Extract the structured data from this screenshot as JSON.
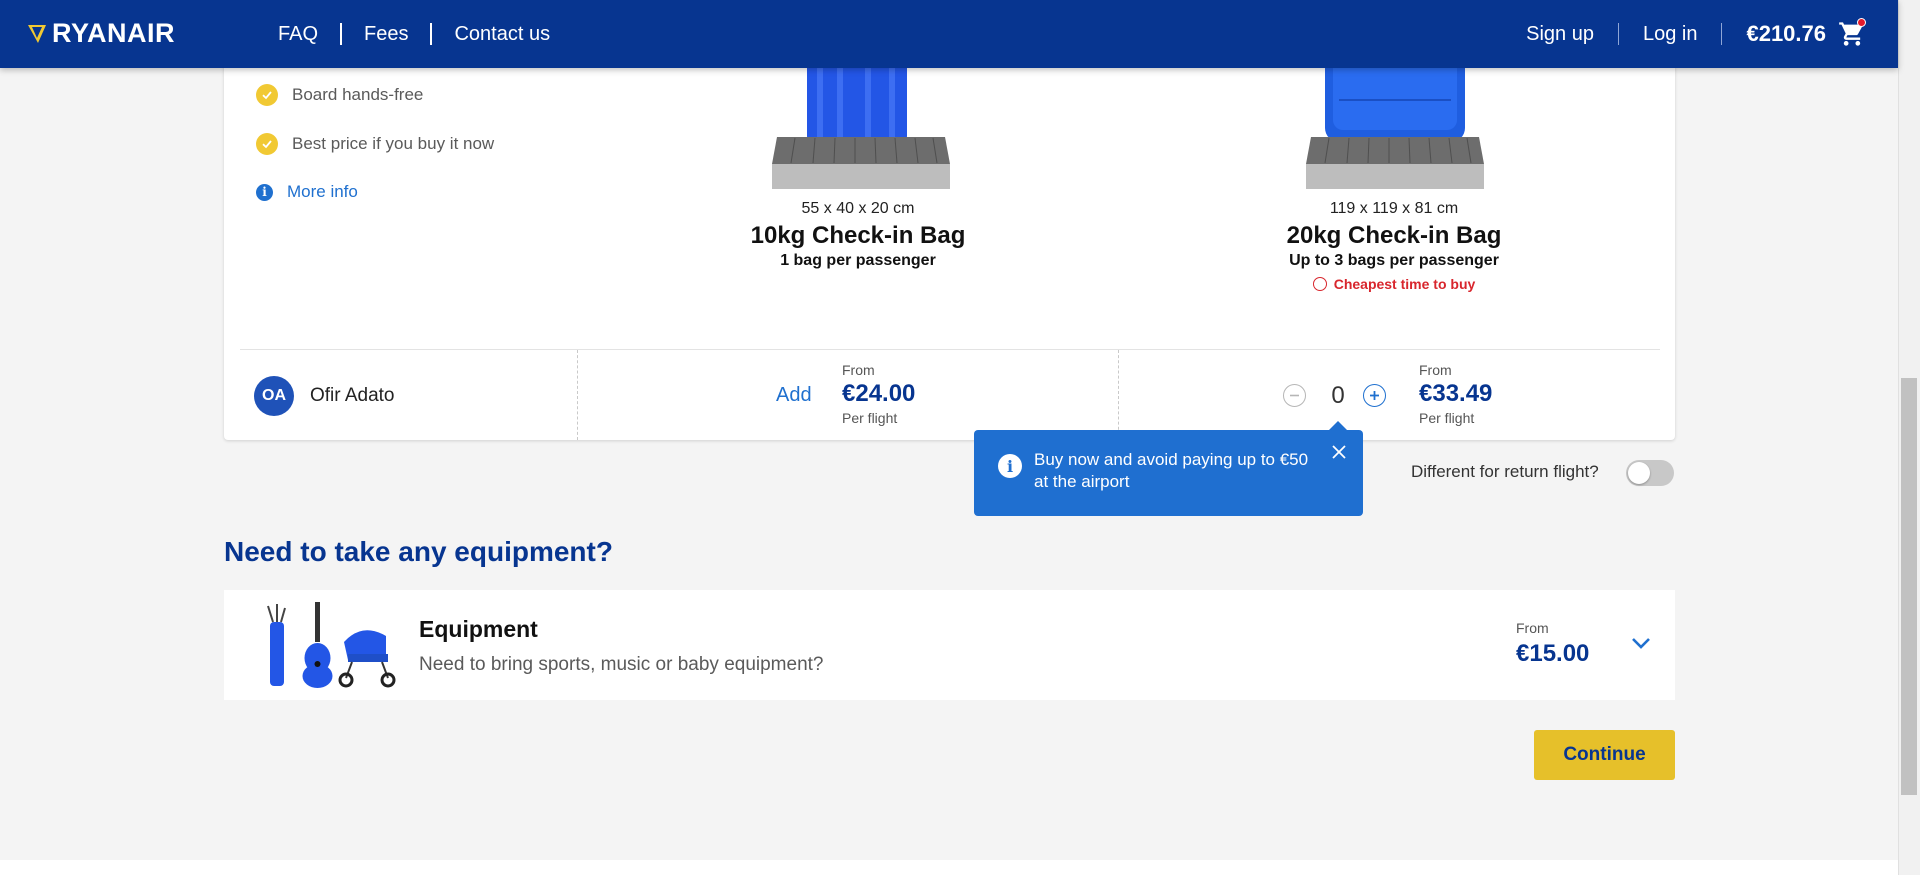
{
  "header": {
    "brand": "RYANAIR",
    "nav": [
      "FAQ",
      "Fees",
      "Contact us"
    ],
    "sign_up": "Sign up",
    "log_in": "Log in",
    "cart_total": "€210.76"
  },
  "benefits": [
    "Board hands-free",
    "Best price if you buy it now"
  ],
  "more_info": "More info",
  "bags": [
    {
      "dims": "55 x 40 x 20 cm",
      "name": "10kg Check-in Bag",
      "sub": "1 bag per passenger"
    },
    {
      "dims": "119 x 119 x 81 cm",
      "name": "20kg Check-in Bag",
      "sub": "Up to 3 bags per passenger",
      "badge": "Cheapest time to buy"
    }
  ],
  "passenger": {
    "initials": "OA",
    "name": "Ofir Adato"
  },
  "bag10": {
    "action": "Add",
    "from": "From",
    "price": "€24.00",
    "per": "Per flight"
  },
  "bag20": {
    "quantity": "0",
    "from": "From",
    "price": "€33.49",
    "per": "Per flight"
  },
  "tooltip": {
    "text": "Buy now and avoid paying up to €50 at the airport"
  },
  "return_toggle": {
    "label": "Different for return flight?",
    "on": false
  },
  "equipment_section": {
    "title": "Need to take any equipment?",
    "card_title": "Equipment",
    "card_sub": "Need to bring sports, music or baby equipment?",
    "from": "From",
    "price": "€15.00"
  },
  "continue_label": "Continue",
  "colors": {
    "brand_blue": "#073590",
    "accent_yellow": "#f1c933",
    "link_blue": "#1f70cf",
    "alert_red": "#d8262d"
  }
}
